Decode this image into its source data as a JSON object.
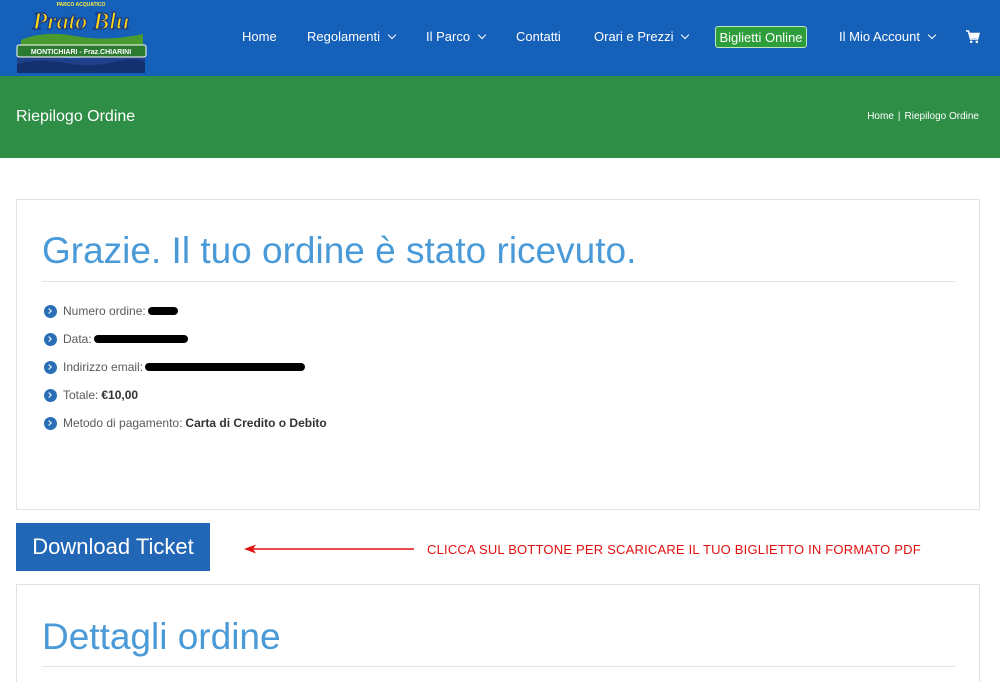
{
  "header": {
    "logo": {
      "top_text": "PARCO ACQUATICO",
      "name": "Prato Blu",
      "subtitle": "MONTICHIARI - Fraz.CHIARINI"
    },
    "nav": [
      {
        "label": "Home",
        "dropdown": false
      },
      {
        "label": "Regolamenti",
        "dropdown": true
      },
      {
        "label": "Il Parco",
        "dropdown": true
      },
      {
        "label": "Contatti",
        "dropdown": false
      },
      {
        "label": "Orari e Prezzi",
        "dropdown": true
      },
      {
        "label": "Biglietti Online",
        "highlight": true
      },
      {
        "label": "Il Mio Account",
        "dropdown": true
      }
    ],
    "cart_icon": "shopping-cart-icon",
    "colors": {
      "bar": "#1560b8",
      "highlight_button": "#2e9e3b"
    }
  },
  "titlebar": {
    "title": "Riepilogo Ordine",
    "breadcrumb": [
      "Home",
      "|",
      "Riepilogo Ordine"
    ],
    "color": "#2f8e46"
  },
  "order": {
    "heading": "Grazie. Il tuo ordine è stato ricevuto.",
    "rows": [
      {
        "label": "Numero ordine:",
        "value": "",
        "redacted": true
      },
      {
        "label": "Data:",
        "value": "",
        "redacted": true
      },
      {
        "label": "Indirizzo email:",
        "value": "",
        "redacted": true
      },
      {
        "label": "Totale:",
        "value": "€10,00"
      },
      {
        "label": "Metodo di pagamento:",
        "value": "Carta di Credito o Debito"
      }
    ]
  },
  "download": {
    "button_label": "Download Ticket",
    "annotation": "CLICCA SUL BOTTONE PER SCARICARE IL TUO BIGLIETTO IN FORMATO PDF",
    "annotation_color": "#e01010"
  },
  "details": {
    "heading": "Dettagli ordine"
  }
}
